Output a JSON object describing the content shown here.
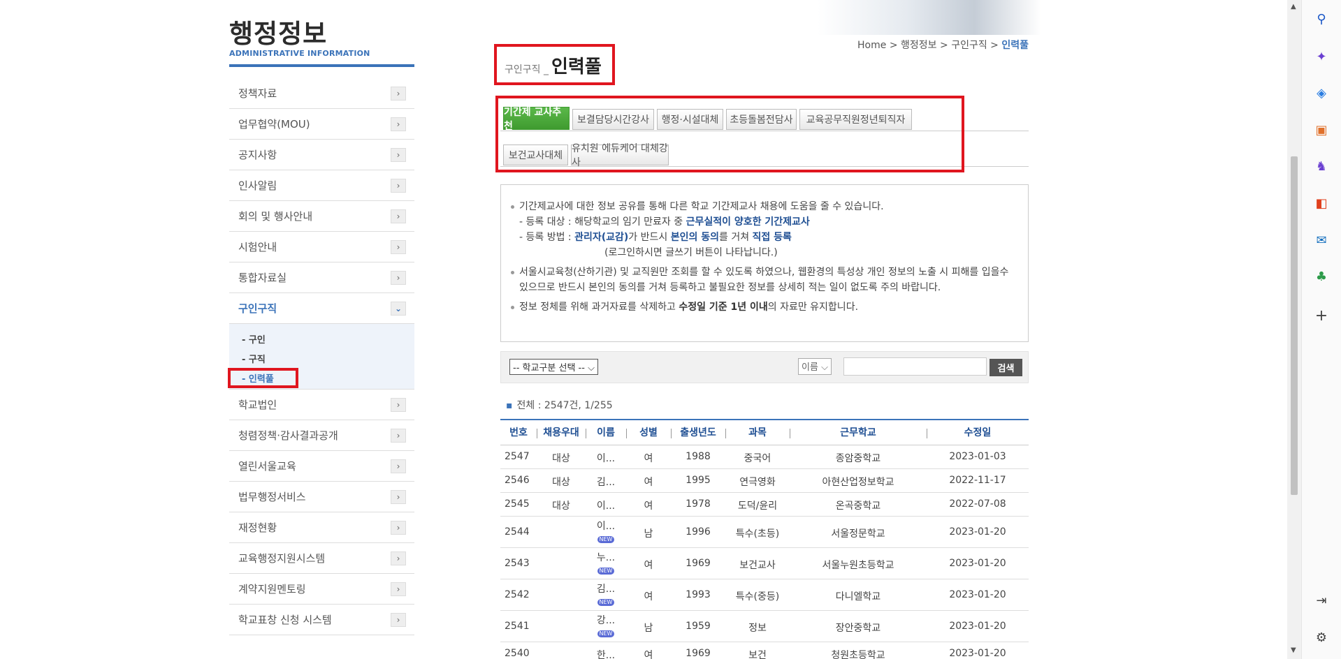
{
  "lnb": {
    "title_ko": "행정정보",
    "title_en": "ADMINISTRATIVE INFORMATION",
    "items_top": [
      "정책자료",
      "업무협약(MOU)",
      "공지사항",
      "인사알림",
      "회의 및 행사안내",
      "시험안내",
      "통합자료실",
      "구인구직"
    ],
    "sub": [
      "- 구인",
      "- 구직",
      "- 인력풀"
    ],
    "items_bottom": [
      "학교법인",
      "청렴정책·감사결과공개",
      "열린서울교육",
      "법무행정서비스",
      "재정현황",
      "교육행정지원시스템",
      "계약지원멘토링",
      "학교표창 신청 시스템"
    ]
  },
  "breadcrumb": {
    "home": "Home",
    "sep": ">",
    "l1": "행정정보",
    "l2": "구인구직",
    "current": "인력풀"
  },
  "page_title": {
    "small": "구인구직 _",
    "big": "인력풀"
  },
  "tabs_row1": [
    "기간제 교사추천",
    "보결담당시간강사",
    "행정·시설대체",
    "초등돌봄전담사",
    "교육공무직원정년퇴직자"
  ],
  "tabs_row2": [
    "보건교사대체",
    "유치원 에듀케어 대체강사"
  ],
  "info": {
    "p1": "기간제교사에 대한 정보 공유를 통해 다른 학교 기간제교사 채용에 도움을 줄 수 있습니다.",
    "p1a_pre": "- 등록 대상 : 해당학교의 임기 만료자 중 ",
    "p1a_b": "근무실적이 양호한 기간제교사",
    "p1b_pre": "- 등록 방법 : ",
    "p1b_b1": "관리자(교감)",
    "p1b_mid": "가 반드시 ",
    "p1b_b2": "본인의 동의",
    "p1b_mid2": "를 거쳐 ",
    "p1b_b3": "직접 등록",
    "p1c": "(로그인하시면 글쓰기 버튼이 나타납니다.)",
    "p2": "서울시교육청(산하기관) 및 교직원만 조회를 할 수 있도록 하였으나, 웹환경의 특성상 개인 정보의 노출 시 피해를 입을수 있으므로 반드시 본인의 동의를 거쳐 등록하고 불필요한 정보를 상세히 적는 일이 없도록 주의 바랍니다.",
    "p3_pre": "정보 정체를 위해 과거자료를 삭제하고 ",
    "p3_b": "수정일 기준 1년 이내",
    "p3_post": "의 자료만 유지합니다."
  },
  "search": {
    "school_select": "-- 학교구분 선택 --",
    "field_select": "이름",
    "button": "검색"
  },
  "total": "전체 : 2547건, 1/255",
  "table": {
    "headers": [
      "번호",
      "채용우대",
      "이름",
      "성별",
      "출생년도",
      "과목",
      "근무학교",
      "수정일"
    ],
    "new_label": "NEW",
    "rows": [
      {
        "no": "2547",
        "pref": "대상",
        "name": "이...",
        "sex": "여",
        "year": "1988",
        "subj": "중국어",
        "school": "종암중학교",
        "date": "2023-01-03",
        "new": false
      },
      {
        "no": "2546",
        "pref": "대상",
        "name": "김...",
        "sex": "여",
        "year": "1995",
        "subj": "연극영화",
        "school": "아현산업정보학교",
        "date": "2022-11-17",
        "new": false
      },
      {
        "no": "2545",
        "pref": "대상",
        "name": "이...",
        "sex": "여",
        "year": "1978",
        "subj": "도덕/윤리",
        "school": "온곡중학교",
        "date": "2022-07-08",
        "new": false
      },
      {
        "no": "2544",
        "pref": "",
        "name": "이...",
        "sex": "남",
        "year": "1996",
        "subj": "특수(초등)",
        "school": "서울정문학교",
        "date": "2023-01-20",
        "new": true
      },
      {
        "no": "2543",
        "pref": "",
        "name": "누...",
        "sex": "여",
        "year": "1969",
        "subj": "보건교사",
        "school": "서울누원초등학교",
        "date": "2023-01-20",
        "new": true
      },
      {
        "no": "2542",
        "pref": "",
        "name": "김...",
        "sex": "여",
        "year": "1993",
        "subj": "특수(중등)",
        "school": "다니엘학교",
        "date": "2023-01-20",
        "new": true
      },
      {
        "no": "2541",
        "pref": "",
        "name": "강...",
        "sex": "남",
        "year": "1959",
        "subj": "정보",
        "school": "장안중학교",
        "date": "2023-01-20",
        "new": true
      },
      {
        "no": "2540",
        "pref": "",
        "name": "한...",
        "sex": "여",
        "year": "1969",
        "subj": "보건",
        "school": "청원초등학교",
        "date": "2023-01-20",
        "new": false
      }
    ]
  },
  "edge_icons": [
    "search-icon",
    "copilot-icon",
    "shopping-tag-icon",
    "tools-icon",
    "games-icon",
    "office-icon",
    "outlook-icon",
    "tree-icon",
    "add-icon",
    "panel-toggle-icon",
    "settings-icon"
  ],
  "colors": {
    "accent": "#3b73b9",
    "tab_active": "#4aa83a",
    "highlight": "#e0161f"
  }
}
